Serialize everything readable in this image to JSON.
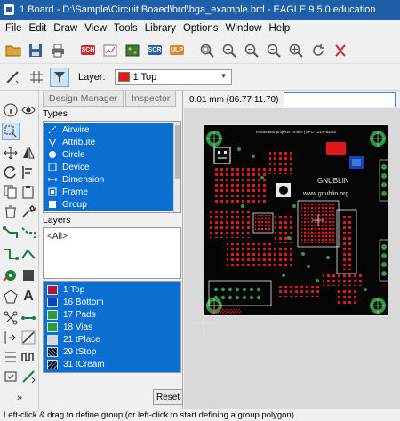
{
  "window": {
    "title": "1 Board - D:\\Sample\\Circuit Boaed\\brd\\bga_example.brd - EAGLE 9.5.0 education"
  },
  "menu": [
    "File",
    "Edit",
    "Draw",
    "View",
    "Tools",
    "Library",
    "Options",
    "Window",
    "Help"
  ],
  "toolbar": {
    "icons": [
      "open-icon",
      "save-icon",
      "print-icon",
      "sch-icon",
      "cam-icon",
      "board-icon",
      "scr-icon",
      "ulp-icon",
      "zoom-fit-icon",
      "zoom-in-icon",
      "zoom-out-icon",
      "zoom-select-icon",
      "zoom-area-icon",
      "redraw-icon",
      "stop-icon"
    ],
    "sch_badge": "SCH",
    "scr_badge": "SCR",
    "ulp_badge": "ULP"
  },
  "layerbar": {
    "label": "Layer:",
    "selected_layer": "1 Top",
    "selected_color": "#e21a1a"
  },
  "panel": {
    "tabs": [
      "Design Manager",
      "Inspector"
    ],
    "types_label": "Types",
    "types": [
      {
        "label": "Airwire",
        "icon": "airwire-icon"
      },
      {
        "label": "Attribute",
        "icon": "attribute-icon"
      },
      {
        "label": "Circle",
        "icon": "circle-icon"
      },
      {
        "label": "Device",
        "icon": "device-icon"
      },
      {
        "label": "Dimension",
        "icon": "dimension-icon"
      },
      {
        "label": "Frame",
        "icon": "frame-icon"
      },
      {
        "label": "Group",
        "icon": "group-icon"
      }
    ],
    "layers_label": "Layers",
    "all_option": "<All>",
    "layers": [
      {
        "label": "1 Top",
        "color": "#b0163a"
      },
      {
        "label": "16 Bottom",
        "color": "#1c3fb5"
      },
      {
        "label": "17 Pads",
        "color": "#2e9a3a"
      },
      {
        "label": "18 Vias",
        "color": "#2e9a3a"
      },
      {
        "label": "21 tPlace",
        "color": "#d8d8d8"
      },
      {
        "label": "29 tStop",
        "color": "#111111"
      },
      {
        "label": "31 tCream",
        "color": "#111111"
      }
    ],
    "reset_label": "Reset"
  },
  "coord": {
    "text": "0.01 mm (86.77 11.70)"
  },
  "board": {
    "silk_text": "embedded projects GmbH | LPC-1114FBD48",
    "logo_text": "GNUBLIN",
    "url_text": "www.gnublin.org",
    "colors": {
      "copper": "#e01818",
      "silk": "#e8e8e8",
      "pads": "#2e9a3a",
      "background": "#050505"
    }
  },
  "status": {
    "text": "Left-click & drag to define group (or left-click to start defining a group polygon)"
  }
}
